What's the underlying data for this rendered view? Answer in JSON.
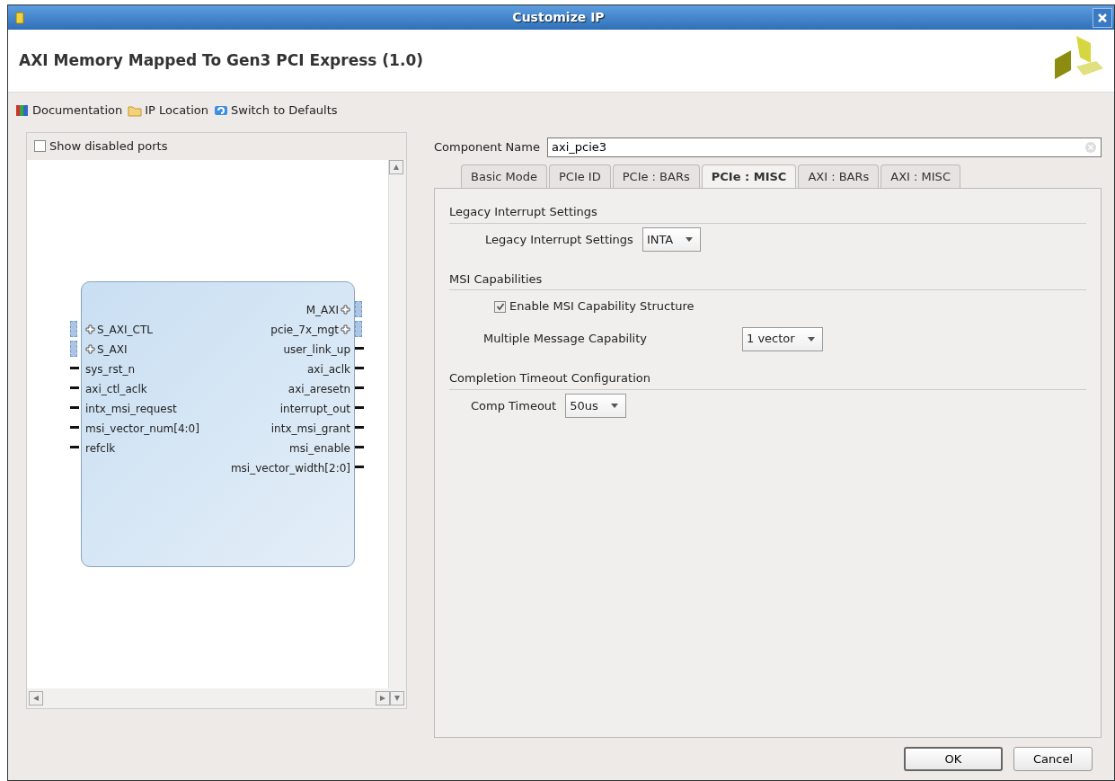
{
  "window": {
    "title": "Customize IP"
  },
  "header": {
    "title": "AXI Memory Mapped To Gen3 PCI Express (1.0)"
  },
  "toolbar": [
    {
      "label": "Documentation",
      "kind": "book"
    },
    {
      "label": "IP Location",
      "kind": "folder"
    },
    {
      "label": "Switch to Defaults",
      "kind": "reset"
    }
  ],
  "show_disabled_ports": {
    "label": "Show disabled ports",
    "checked": false
  },
  "block": {
    "left_ports": [
      {
        "name": "S_AXI_CTL",
        "kind": "bus"
      },
      {
        "name": "S_AXI",
        "kind": "bus"
      },
      {
        "name": "sys_rst_n",
        "kind": "wire"
      },
      {
        "name": "axi_ctl_aclk",
        "kind": "wire"
      },
      {
        "name": "intx_msi_request",
        "kind": "wire"
      },
      {
        "name": "msi_vector_num[4:0]",
        "kind": "wire"
      },
      {
        "name": "refclk",
        "kind": "wire"
      }
    ],
    "right_ports": [
      {
        "name": "M_AXI",
        "kind": "bus"
      },
      {
        "name": "pcie_7x_mgt",
        "kind": "bus"
      },
      {
        "name": "user_link_up",
        "kind": "wire"
      },
      {
        "name": "axi_aclk",
        "kind": "wire"
      },
      {
        "name": "axi_aresetn",
        "kind": "wire"
      },
      {
        "name": "interrupt_out",
        "kind": "wire"
      },
      {
        "name": "intx_msi_grant",
        "kind": "wire"
      },
      {
        "name": "msi_enable",
        "kind": "wire"
      },
      {
        "name": "msi_vector_width[2:0]",
        "kind": "wire"
      }
    ]
  },
  "component_name": {
    "label": "Component Name",
    "value": "axi_pcie3"
  },
  "tabs": [
    {
      "label": "Basic Mode",
      "selected": false
    },
    {
      "label": "PCIe ID",
      "selected": false
    },
    {
      "label": "PCIe : BARs",
      "selected": false
    },
    {
      "label": "PCIe : MISC",
      "selected": true
    },
    {
      "label": "AXI : BARs",
      "selected": false
    },
    {
      "label": "AXI : MISC",
      "selected": false
    }
  ],
  "sections": [
    {
      "title": "Legacy Interrupt Settings",
      "fields": [
        {
          "kind": "select",
          "label": "Legacy Interrupt Settings",
          "value": "INTA"
        }
      ]
    },
    {
      "title": "MSI Capabilities",
      "fields": [
        {
          "kind": "checkbox",
          "label": "Enable MSI Capability Structure",
          "checked": true
        },
        {
          "kind": "select",
          "label": "Multiple Message Capability",
          "value": "1 vector"
        }
      ]
    },
    {
      "title": "Completion Timeout Configuration",
      "fields": [
        {
          "kind": "select",
          "label": "Comp Timeout",
          "value": "50us"
        }
      ]
    }
  ],
  "buttons": [
    {
      "label": "OK",
      "default": true
    },
    {
      "label": "Cancel",
      "default": false
    }
  ]
}
